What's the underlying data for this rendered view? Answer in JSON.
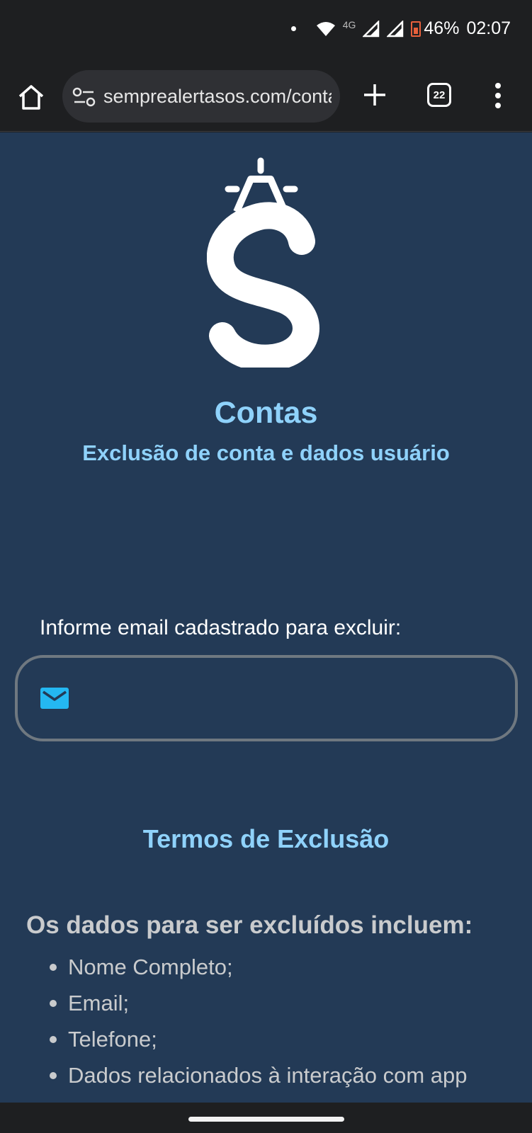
{
  "status_bar": {
    "network_label": "4G",
    "battery_level": "46%",
    "time": "02:07"
  },
  "browser": {
    "url": "semprealertasos.com/contas",
    "tab_count": "22"
  },
  "header": {
    "title": "Contas",
    "subtitle": "Exclusão de conta e dados usuário"
  },
  "form": {
    "email_label": "Informe email cadastrado para excluir:",
    "email_value": ""
  },
  "terms": {
    "title": "Termos de Exclusão",
    "data_heading": "Os dados para ser excluídos incluem:",
    "items": [
      "Nome Completo;",
      "Email;",
      "Telefone;",
      "Dados relacionados à interação com app"
    ]
  },
  "colors": {
    "page_background": "#233a56",
    "accent_text": "#8fd2fb",
    "mail_icon": "#24b8f2"
  },
  "icons": [
    "home-icon",
    "site-settings-icon",
    "plus-icon",
    "tab-switcher-icon",
    "more-vert-icon",
    "mail-icon",
    "wifi-icon",
    "signal-icon",
    "battery-icon"
  ]
}
